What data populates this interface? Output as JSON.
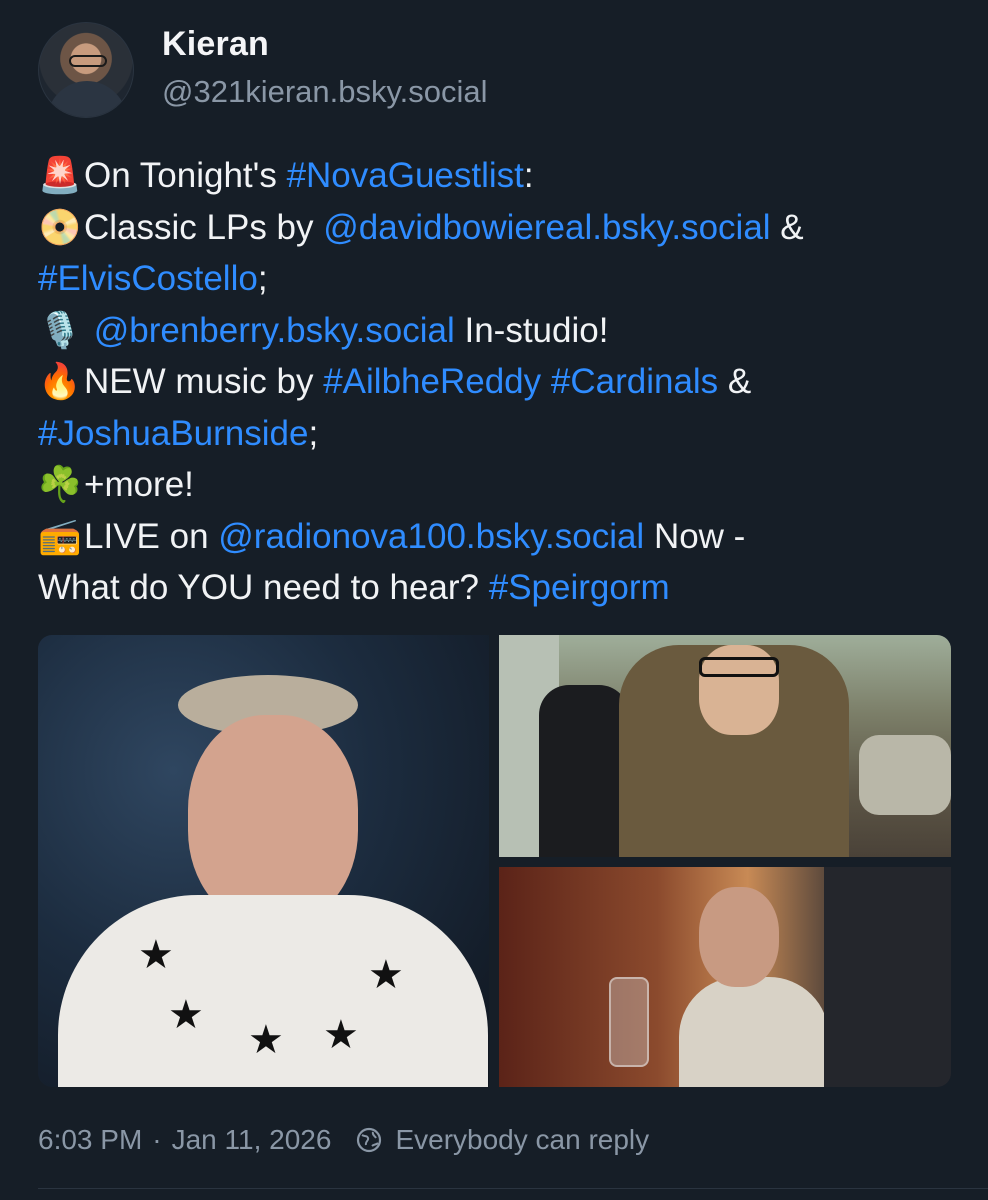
{
  "author": {
    "display_name": "Kieran",
    "handle": "@321kieran.bsky.social"
  },
  "post": {
    "lines": [
      {
        "emoji": "🚨",
        "parts": [
          {
            "t": "On Tonight's ",
            "link": false
          },
          {
            "t": "#NovaGuestlist",
            "link": true
          },
          {
            "t": ":",
            "link": false
          }
        ]
      },
      {
        "emoji": "📀",
        "parts": [
          {
            "t": "Classic LPs by ",
            "link": false
          },
          {
            "t": "@davidbowiereal.bsky.social",
            "link": true
          },
          {
            "t": " &",
            "link": false
          }
        ]
      },
      {
        "emoji": "",
        "parts": [
          {
            "t": "#ElvisCostello",
            "link": true
          },
          {
            "t": ";",
            "link": false
          }
        ]
      },
      {
        "emoji": "🎙️",
        "parts": [
          {
            "t": " @brenberry.bsky.social",
            "link": true
          },
          {
            "t": " In-studio!",
            "link": false
          }
        ]
      },
      {
        "emoji": "🔥",
        "parts": [
          {
            "t": "NEW music by ",
            "link": false
          },
          {
            "t": "#AilbheReddy",
            "link": true
          },
          {
            "t": " ",
            "link": false
          },
          {
            "t": "#Cardinals",
            "link": true
          },
          {
            "t": " &",
            "link": false
          }
        ]
      },
      {
        "emoji": "",
        "parts": [
          {
            "t": "#JoshuaBurnside",
            "link": true
          },
          {
            "t": ";",
            "link": false
          }
        ]
      },
      {
        "emoji": "☘️",
        "parts": [
          {
            "t": "+more!",
            "link": false
          }
        ]
      },
      {
        "emoji": "📻",
        "parts": [
          {
            "t": "LIVE on ",
            "link": false
          },
          {
            "t": "@radionova100.bsky.social",
            "link": true
          },
          {
            "t": " Now -",
            "link": false
          }
        ]
      },
      {
        "emoji": "",
        "parts": [
          {
            "t": "What do YOU need to hear? ",
            "link": false
          },
          {
            "t": "#Speirgorm",
            "link": true
          }
        ]
      }
    ]
  },
  "footer": {
    "time": "6:03 PM",
    "separator": "·",
    "date": "Jan 11, 2026",
    "reply_setting": "Everybody can reply"
  },
  "colors": {
    "background": "#161e27",
    "link": "#2f8cff",
    "muted": "#8a97a6"
  }
}
